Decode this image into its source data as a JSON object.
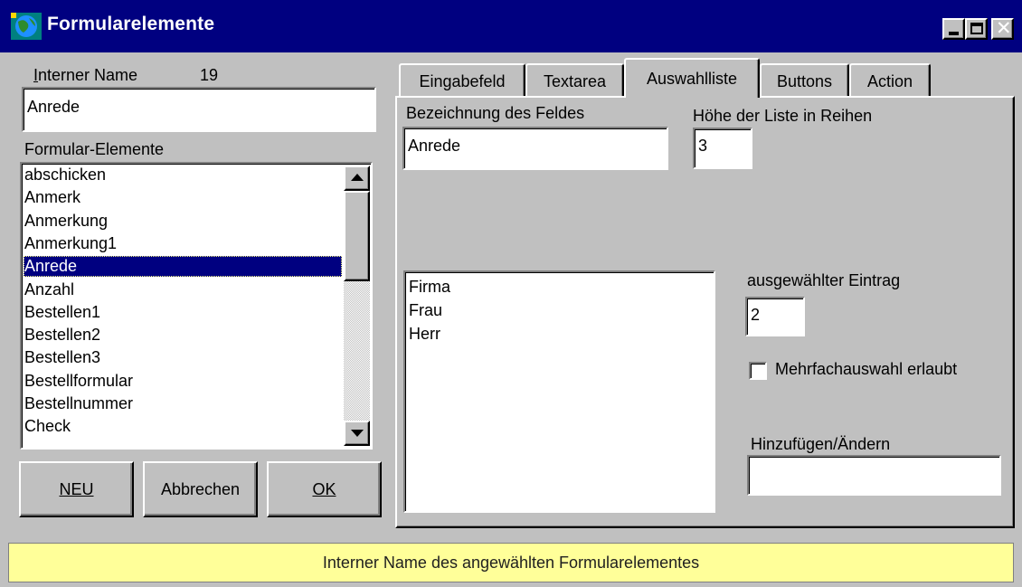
{
  "window": {
    "title": "Formularelemente"
  },
  "left": {
    "internal_name_label": "Interner Name",
    "internal_name_count": "19",
    "internal_name_value": "Anrede",
    "elements_label": "Formular-Elemente",
    "elements": [
      "abschicken",
      "Anmerk",
      "Anmerkung",
      "Anmerkung1",
      "Anrede",
      "Anzahl",
      "Bestellen1",
      "Bestellen2",
      "Bestellen3",
      "Bestellformular",
      "Bestellnummer",
      "Check"
    ],
    "selected_index": 4,
    "buttons": {
      "new": "NEU",
      "cancel": "Abbrechen",
      "ok": "OK"
    }
  },
  "tabs": [
    "Eingabefeld",
    "Textarea",
    "Auswahlliste",
    "Buttons",
    "Action"
  ],
  "active_tab": "Auswahlliste",
  "auswahlliste": {
    "field_label": "Bezeichnung des Feldes",
    "field_value": "Anrede",
    "height_label": "Höhe der Liste in Reihen",
    "height_value": "3",
    "options": [
      "Firma",
      "Frau",
      "Herr"
    ],
    "selected_entry_label": "ausgewählter Eintrag",
    "selected_entry_value": "2",
    "multiselect_label": "Mehrfachauswahl erlaubt",
    "multiselect_checked": false,
    "add_change_label": "Hinzufügen/Ändern",
    "add_change_value": ""
  },
  "status": {
    "text": "Interner Name des angewählten Formularelementes"
  },
  "colors": {
    "titlebar": "#000080",
    "selection": "#000080",
    "status_bg": "#ffff99",
    "face": "#c0c0c0"
  }
}
